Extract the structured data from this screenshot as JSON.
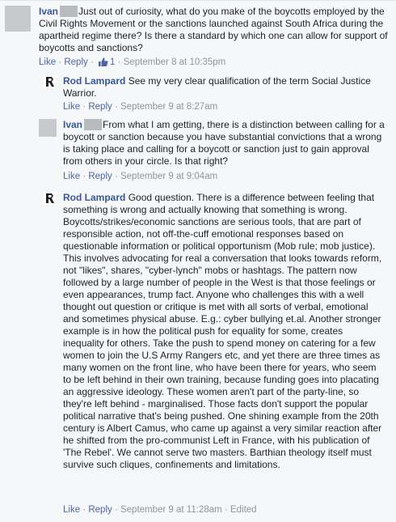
{
  "comments": [
    {
      "author": "Ivan",
      "text": "Just out of curiosity, what do you make of the boycotts employed by the Civil Rights Movement or the sanctions launched against South Africa during the apartheid regime there? Is there a standard by which one can allow for support of boycotts and sanctions?",
      "like_label": "Like",
      "reply_label": "Reply",
      "like_count": "1",
      "timestamp": "September 8 at 10:35pm"
    },
    {
      "author": "Rod Lampard",
      "text": "See my very clear qualification of the term Social Justice Warrior.",
      "like_label": "Like",
      "reply_label": "Reply",
      "timestamp": "September 9 at 8:27am"
    },
    {
      "author": "Ivan",
      "text": "From what I am getting, there is a distinction between calling for a boycott or sanction because you have substantial convictions that a wrong is taking place and calling for a boycott or sanction just to gain approval from others in your circle. Is that right?",
      "like_label": "Like",
      "reply_label": "Reply",
      "timestamp": "September 9 at 9:04am"
    },
    {
      "author": "Rod Lampard",
      "text": "Good question. There is a difference between feeling that something is wrong and actually knowing that something is wrong. Boycotts/strikes/economic sanctions are serious tools, that are part of responsible action, not off-the-cuff emotional responses based on questionable information or political opportunism (Mob rule; mob justice). This involves advocating for real a conversation that looks towards reform, not \"likes\", shares, \"cyber-lynch\" mobs or hashtags. The pattern now followed by a large number of people in the West is that those feelings or even appearances, trump fact. Anyone who challenges this with a well thought out question or critique is met with all sorts of verbal, emotional and sometimes physical abuse. E.g.: cyber bullying et.al. Another stronger example is in how the political push for equality for some, creates inequality for others. Take the push to spend money on catering for a few women to join the U.S Army Rangers etc, and yet there are three times as many women on the front line, who have been there for years, who seem to be left behind in their own training, because funding goes into placating an aggressive ideology. These women aren't part of the party-line, so they're left behind - marginalised. Those facts don't support the popular political narrative that's being pushed. One shining example from the 20th century is Albert Camus, who came up against a very similar reaction after he shifted from the pro-communist Left in France, with his publication of 'The Rebel'. We cannot serve two masters. Barthian theology itself must survive such cliques, confinements and limitations.",
      "like_label": "Like",
      "reply_label": "Reply",
      "timestamp": "September 9 at 11:28am",
      "edited_label": "Edited"
    }
  ]
}
